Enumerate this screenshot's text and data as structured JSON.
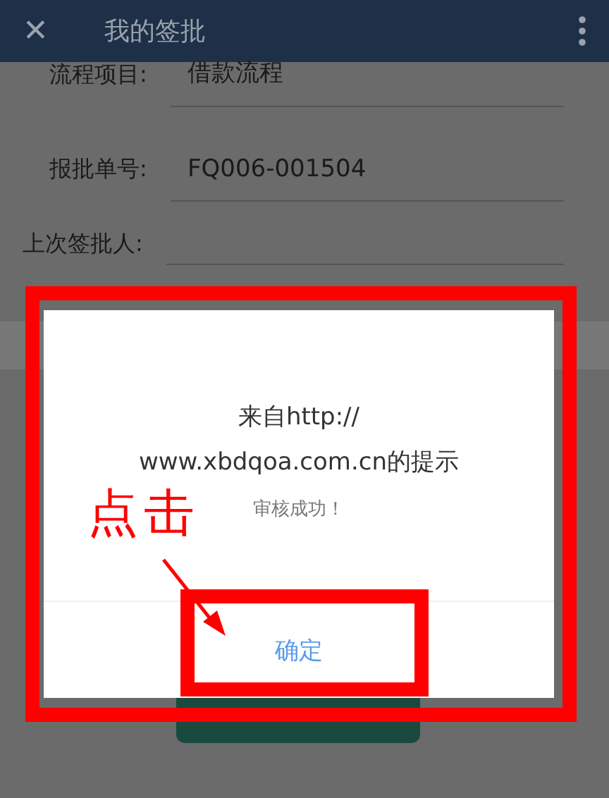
{
  "app_bar": {
    "close_icon": "✕",
    "title": "我的签批"
  },
  "fields": [
    {
      "label": "流程项目:",
      "value": "借款流程"
    },
    {
      "label": "报批单号:",
      "value": "FQ006-001504"
    },
    {
      "label": "上次签批人:"
    }
  ],
  "dialog": {
    "title": "来自http://\nwww.xbdqoa.com.cn的提示",
    "message": "审核成功！",
    "button": "确定"
  },
  "annotation": {
    "text": "点击"
  }
}
